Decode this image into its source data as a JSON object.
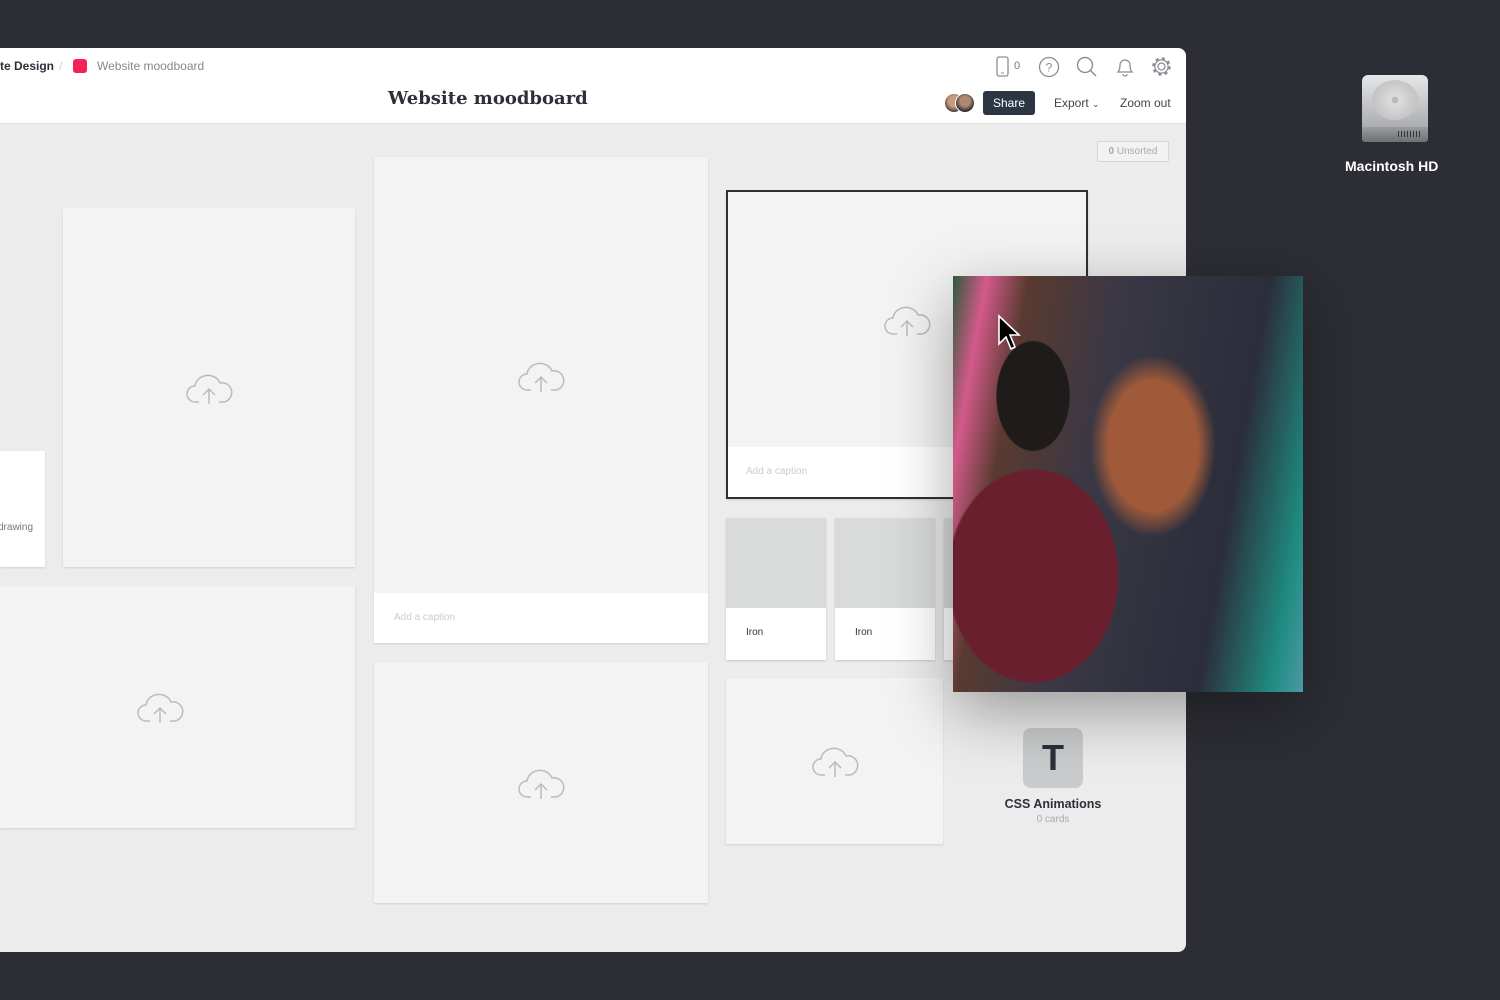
{
  "breadcrumb": {
    "parent": "te Design",
    "separator": "/",
    "current": "Website moodboard",
    "color": "#f2235a"
  },
  "header": {
    "title": "Website moodboard",
    "device_count": "0",
    "share_label": "Share",
    "export_label": "Export",
    "zoom_label": "Zoom out"
  },
  "canvas": {
    "unsorted_count": "0",
    "unsorted_label": "Unsorted",
    "partial_card_text": "drawing",
    "caption_placeholder": "Add a caption",
    "small_cards": [
      {
        "label": "Iron"
      },
      {
        "label": "Iron"
      }
    ],
    "board": {
      "letter": "T",
      "name": "CSS Animations",
      "count": "0 cards"
    }
  },
  "desktop": {
    "drive_label": "Macintosh HD"
  }
}
